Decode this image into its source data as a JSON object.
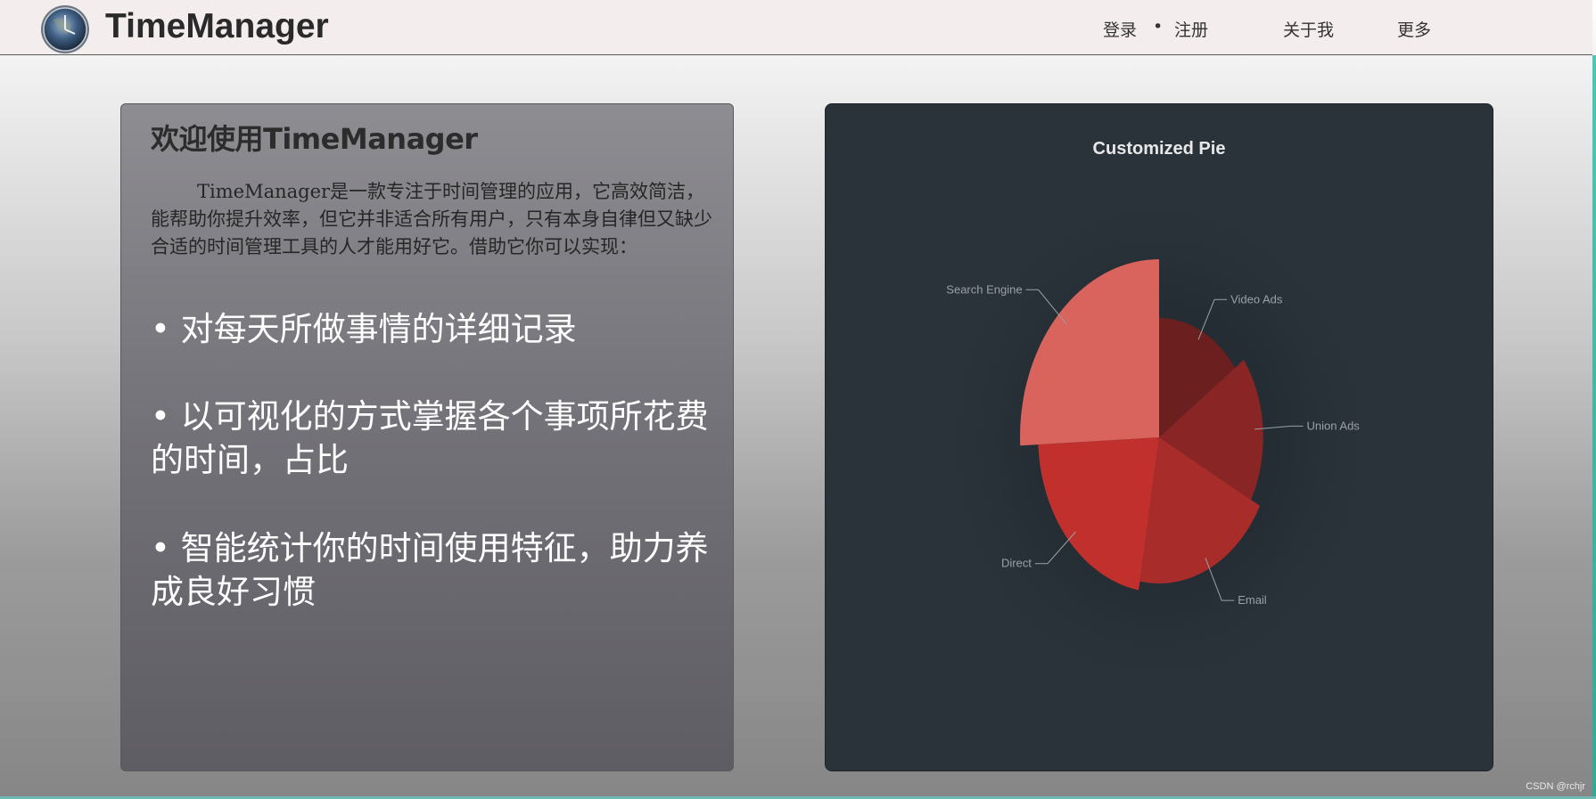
{
  "nav": {
    "brand": "TimeManager",
    "login": "登录",
    "separator": "•",
    "register": "注册",
    "about": "关于我",
    "more": "更多"
  },
  "intro": {
    "title": "欢迎使用TimeManager",
    "description": "TimeManager是一款专注于时间管理的应用，它高效简洁，能帮助你提升效率，但它并非适合所有用户，只有本身自律但又缺少合适的时间管理工具的人才能用好它。借助它你可以实现：",
    "features": [
      "• 对每天所做事情的详细记录",
      "• 以可视化的方式掌握各个事项所花费的时间，占比",
      "• 智能统计你的时间使用特征，助力养成良好习惯"
    ]
  },
  "chart_data": {
    "type": "pie",
    "title": "Customized Pie",
    "subtype": "rose",
    "categories": [
      "Video Ads",
      "Union Ads",
      "Email",
      "Direct",
      "Search Engine"
    ],
    "values": [
      235,
      274,
      310,
      335,
      400
    ],
    "colors": [
      "#6b1f1f",
      "#8a2525",
      "#a82c2a",
      "#c2302d",
      "#d9635d"
    ],
    "legend": "none",
    "label_color": "#9aa0a6",
    "background": "#2a323a"
  },
  "footer": {
    "watermark": "CSDN @rchjr"
  }
}
